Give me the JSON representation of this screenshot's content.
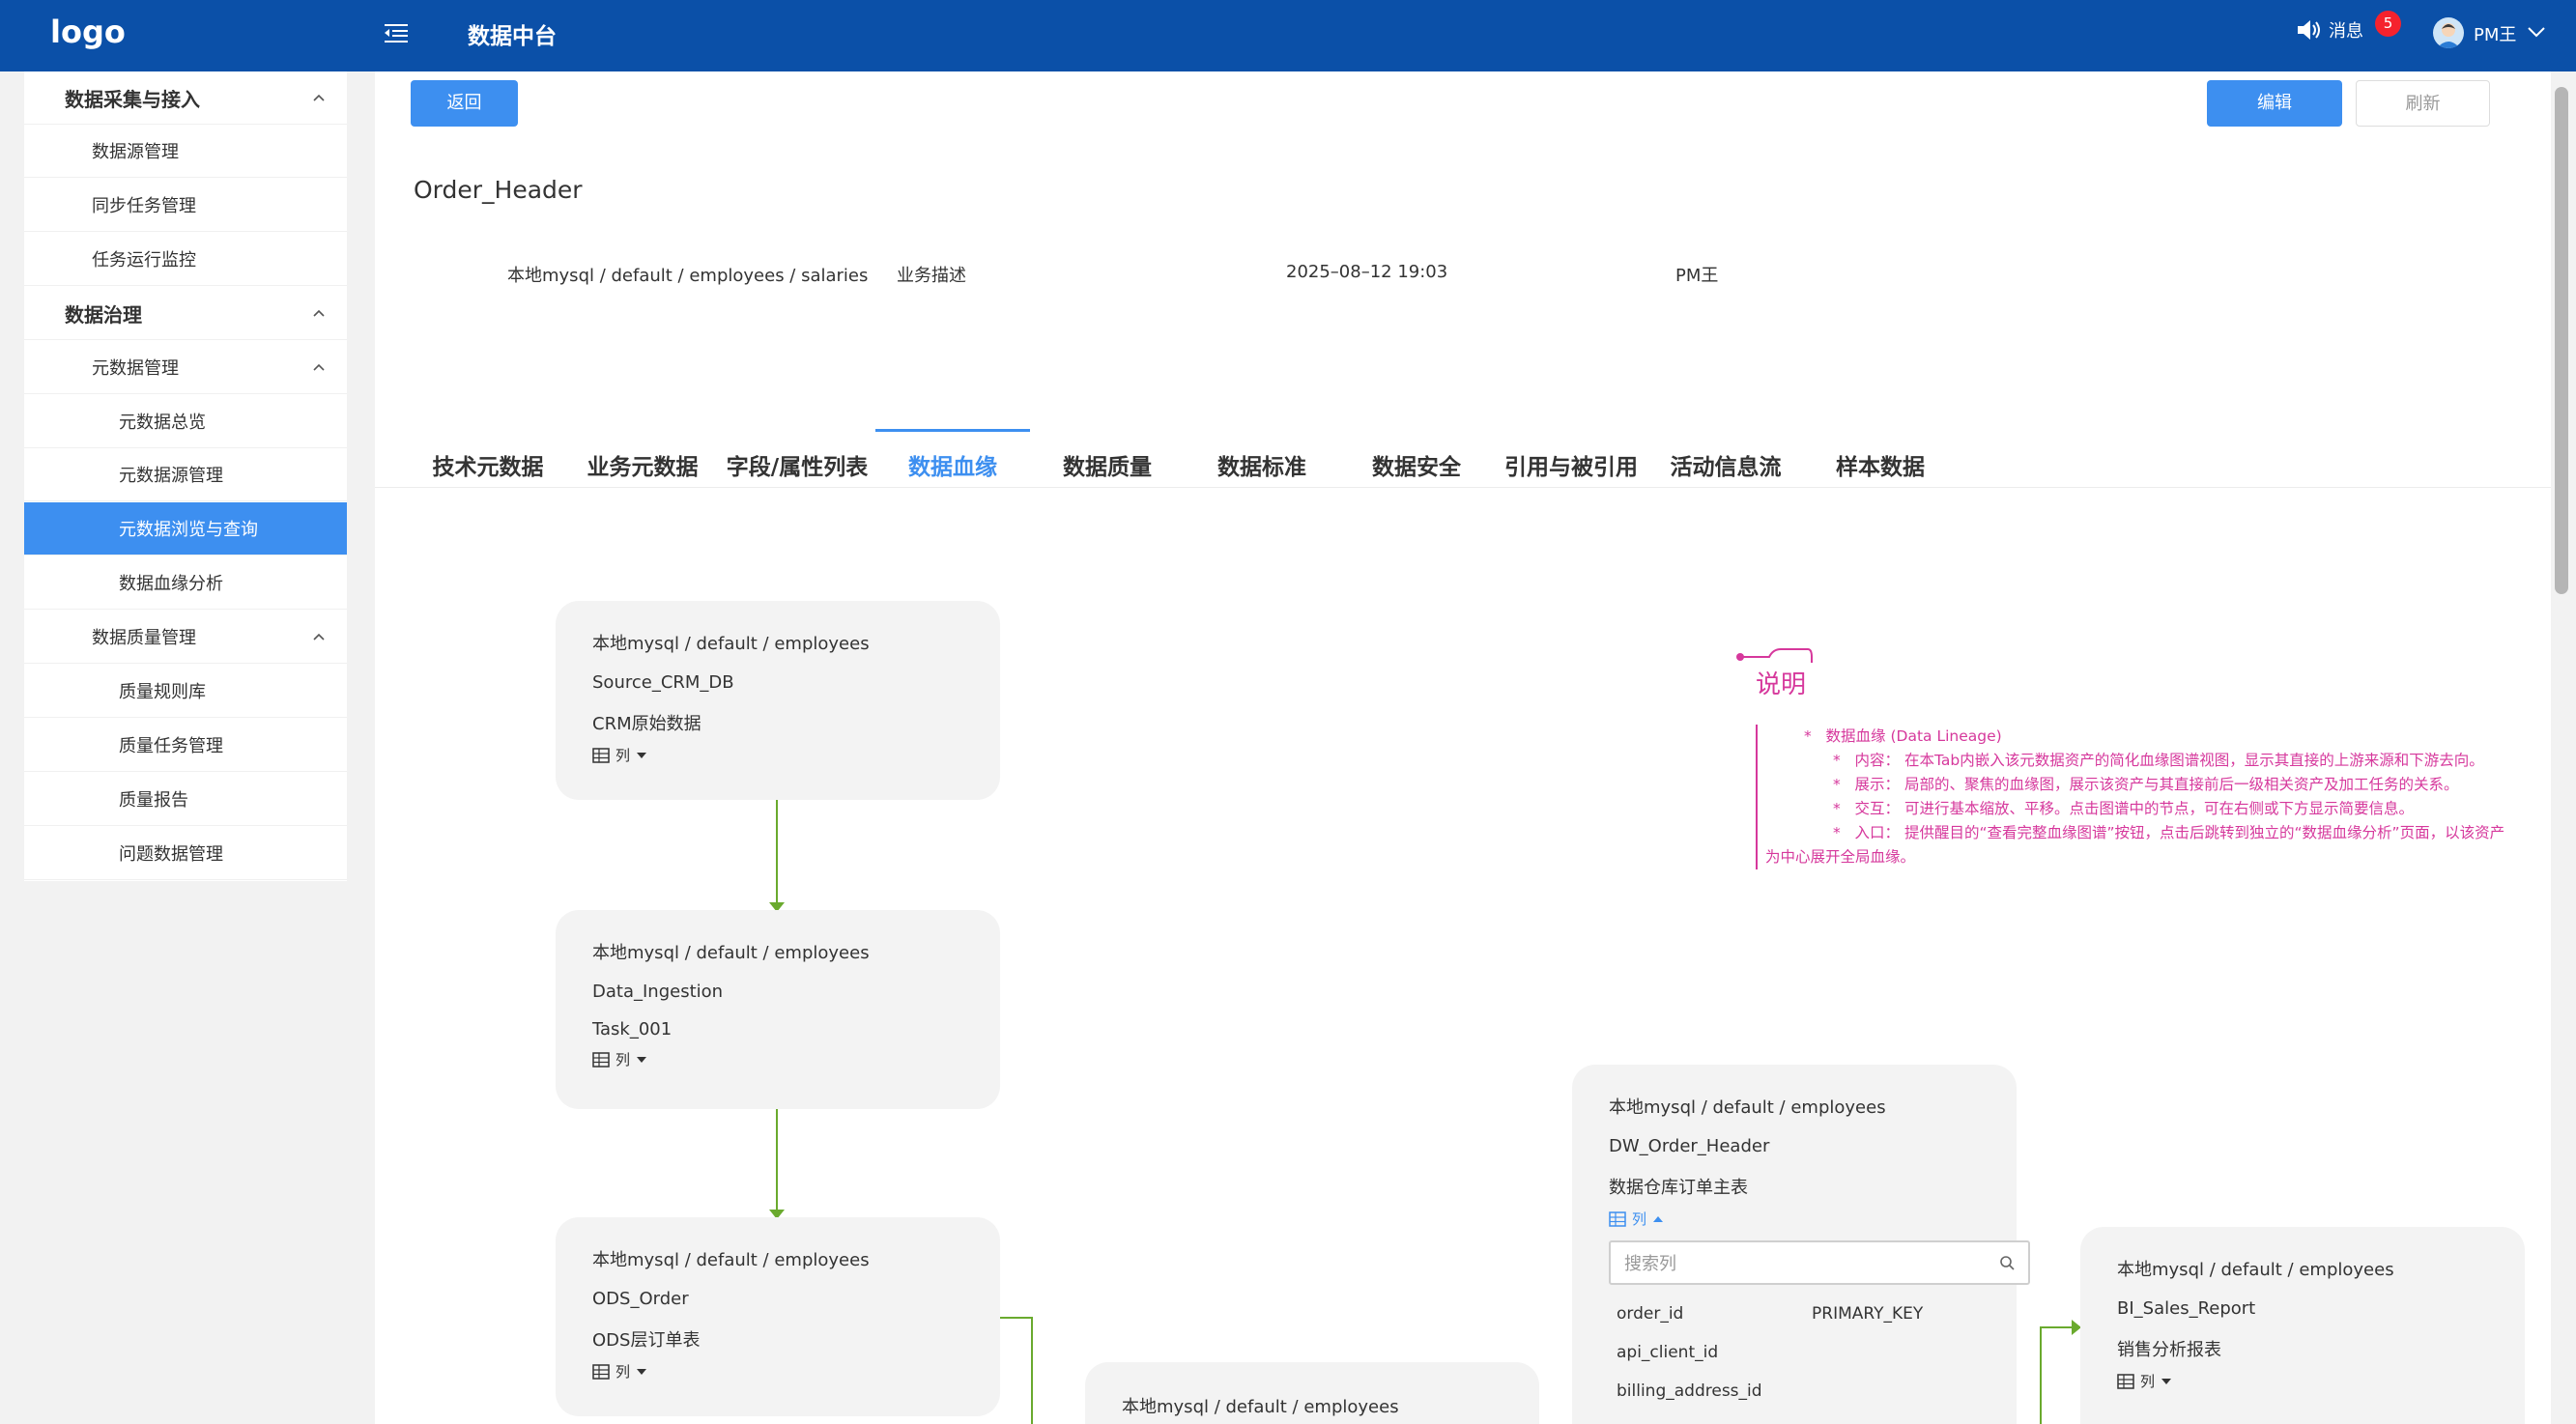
{
  "topbar": {
    "logo": "logo",
    "title": "数据中台",
    "messages_label": "消息",
    "messages_count": "5",
    "user": "PM王"
  },
  "sidebar": [
    {
      "label": "数据采集与接入",
      "level": 1,
      "expanded": true
    },
    {
      "label": "数据源管理",
      "level": 2
    },
    {
      "label": "同步任务管理",
      "level": 2
    },
    {
      "label": "任务运行监控",
      "level": 2
    },
    {
      "label": "数据治理",
      "level": 1,
      "expanded": true
    },
    {
      "label": "元数据管理",
      "level": 2,
      "expanded": true
    },
    {
      "label": "元数据总览",
      "level": 3
    },
    {
      "label": "元数据源管理",
      "level": 3
    },
    {
      "label": "元数据浏览与查询",
      "level": 3,
      "active": true
    },
    {
      "label": "数据血缘分析",
      "level": 3
    },
    {
      "label": "数据质量管理",
      "level": 2,
      "expanded": true
    },
    {
      "label": "质量规则库",
      "level": 3
    },
    {
      "label": "质量任务管理",
      "level": 3
    },
    {
      "label": "质量报告",
      "level": 3
    },
    {
      "label": "问题数据管理",
      "level": 3
    }
  ],
  "actions": {
    "back": "返回",
    "edit": "编辑",
    "refresh": "刷新"
  },
  "asset": {
    "name": "Order_Header",
    "path": "本地mysql / default / employees / salaries",
    "business_desc": "业务描述",
    "updated": "2025–08–12 19:03",
    "owner": "PM王"
  },
  "tabs": [
    "技术元数据",
    "业务元数据",
    "字段/属性列表",
    "数据血缘",
    "数据质量",
    "数据标准",
    "数据安全",
    "引用与被引用",
    "活动信息流",
    "样本数据"
  ],
  "lineage": {
    "col_label": "列",
    "nodes": [
      {
        "path": "本地mysql / default / employees",
        "name": "Source_CRM_DB",
        "desc": "CRM原始数据"
      },
      {
        "path": "本地mysql / default / employees",
        "name": "Data_Ingestion",
        "desc": "Task_001"
      },
      {
        "path": "本地mysql / default / employees",
        "name": "ODS_Order",
        "desc": "ODS层订单表"
      },
      {
        "path": "本地mysql / default / employees"
      },
      {
        "path": "本地mysql / default / employees",
        "name": "DW_Order_Header",
        "desc": "数据仓库订单主表"
      },
      {
        "path": "本地mysql / default / employees",
        "name": "BI_Sales_Report",
        "desc": "销售分析报表"
      }
    ],
    "search_placeholder": "搜索列",
    "columns": [
      {
        "name": "order_id",
        "key": "PRIMARY_KEY"
      },
      {
        "name": "api_client_id",
        "key": ""
      },
      {
        "name": "billing_address_id",
        "key": ""
      }
    ]
  },
  "note": {
    "title": "说明",
    "lines": [
      {
        "bullet": "*",
        "text": "数据血缘 (Data Lineage)",
        "level": 1
      },
      {
        "bullet": "*",
        "text": "内容：  在本Tab内嵌入该元数据资产的简化血缘图谱视图，显示其直接的上游来源和下游去向。",
        "level": 2
      },
      {
        "bullet": "*",
        "text": "展示：  局部的、聚焦的血缘图，展示该资产与其直接前后一级相关资产及加工任务的关系。",
        "level": 2
      },
      {
        "bullet": "*",
        "text": "交互：  可进行基本缩放、平移。点击图谱中的节点，可在右侧或下方显示简要信息。",
        "level": 2
      },
      {
        "bullet": "*",
        "text": "入口：  提供醒目的“查看完整血缘图谱”按钮，点击后跳转到独立的“数据血缘分析”页面，以该资产",
        "level": 2
      },
      {
        "bullet": "",
        "text": "为中心展开全局血缘。",
        "level": 0
      }
    ]
  },
  "colors": {
    "header": "#0b50a8",
    "primary": "#3d8ff0",
    "edge": "#6aaa2e",
    "note": "#d6389c"
  }
}
